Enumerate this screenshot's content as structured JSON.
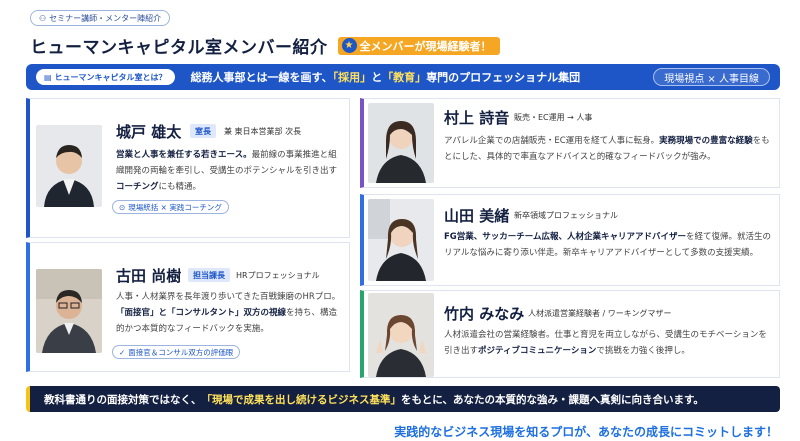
{
  "header": {
    "pill_label": "セミナー講師・メンター陣紹介",
    "title": "ヒューマンキャピタル室メンバー紹介",
    "badge": "全メンバーが現場経験者！"
  },
  "banner": {
    "pill_label": "ヒューマンキャピタル室とは？",
    "text_pre": "総務人事部とは一線を画す、",
    "text_hl1": "「採用」",
    "text_mid": "と",
    "text_hl2": "「教育」",
    "text_post": "専門のプロフェッショナル集団",
    "right_pill": "現場視点 × 人事目線"
  },
  "members": [
    {
      "name": "城戸 雄太",
      "badge": "室長",
      "role": "兼 東日本営業部 次長",
      "desc_b1": "営業と人事を兼任する若きエース。",
      "desc_1": "最前線の事業推進と組織開発の両輪を牽引し、受講生のポテンシャルを引き出す",
      "desc_b2": "コーチング",
      "desc_2": "にも精通。",
      "tag": "現場統括 × 実践コーチング"
    },
    {
      "name": "古田 尚樹",
      "badge": "担当課長",
      "role": "HRプロフェッショナル",
      "desc_1": "人事・人材業界を長年渡り歩いてきた百戦錬磨のHRプロ。",
      "desc_b1": "「面接官」と「コンサルタント」双方の視線",
      "desc_2": "を持ち、構造的かつ本質的なフィードバックを実施。",
      "tag": "面接官＆コンサル双方の評価眼"
    },
    {
      "name": "村上 詩音",
      "role": "販売・EC運用 → 人事",
      "desc_1": "アパレル企業での店舗販売・EC運用を経て人事に転身。",
      "desc_b1": "実務現場での豊富な経験",
      "desc_2": "をもとにした、具体的で率直なアドバイスと的確なフィードバックが強み。"
    },
    {
      "name": "山田 美緒",
      "role": "新卒領域プロフェッショナル",
      "desc_b1": "FG営業、サッカーチーム広報、人材企業キャリアアドバイザー",
      "desc_1": "を経て復帰。就活生のリアルな悩みに寄り添い伴走。新卒キャリアアドバイザーとして多数の支援実績。"
    },
    {
      "name": "竹内 みなみ",
      "role": "人材派遣営業経験者 / ワーキングマザー",
      "desc_1": "人材派遣会社の営業経験者。仕事と育児を両立しながら、受講生のモチベーションを引き出す",
      "desc_b1": "ポジティブコミュニケーション",
      "desc_2": "で挑戦を力強く後押し。"
    }
  ],
  "bottom": {
    "pre": "教科書通りの面接対策ではなく、",
    "hl": "「現場で成果を出し続けるビジネス基準」",
    "post": "をもとに、あなたの本質的な強み・課題へ真剣に向き合います。"
  },
  "footer": "実践的なビジネス現場を知るプロが、あなたの成長にコミットします！",
  "colors": {
    "primary": "#1e56c8",
    "accent": "#f5a623",
    "dark": "#142042",
    "highlight": "#ffe15a"
  },
  "icons": [
    "people-icon",
    "star-icon",
    "building-icon",
    "chat-icon",
    "check-icon"
  ]
}
